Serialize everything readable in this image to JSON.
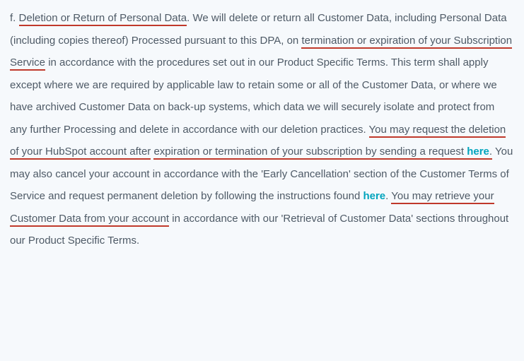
{
  "clause": {
    "prefix": "f. ",
    "u1": "Deletion or Return of Personal Data",
    "t1": ". We will delete or return all Customer Data, including Personal Data (including copies thereof) Processed pursuant to this DPA, on ",
    "u2": "termination or expiration of your Subscription Service",
    "t2": " in accordance with the procedures set out in our Product Specific Terms. This term shall apply except where we are required by applicable law to retain some or all of the Customer Data, or where we have archived Customer Data on back-up systems, which data we will securely isolate and protect from any further Processing and delete in accordance with our deletion practices. ",
    "u3a": "You may request the deletion of your HubSpot account after",
    "u3b": "expiration or termination of your subscription by sending a request ",
    "link1": "here",
    "t3period": ".",
    "t4": " You may also cancel your account in accordance with the 'Early Cancellation' section of the Customer Terms of Service and request permanent deletion by following the instructions found ",
    "link2": "here",
    "t5period": ". ",
    "u4": "You may retrieve your Customer Data from your account",
    "t6": " in accordance with our 'Retrieval of Customer Data' sections throughout our Product Specific Terms."
  }
}
